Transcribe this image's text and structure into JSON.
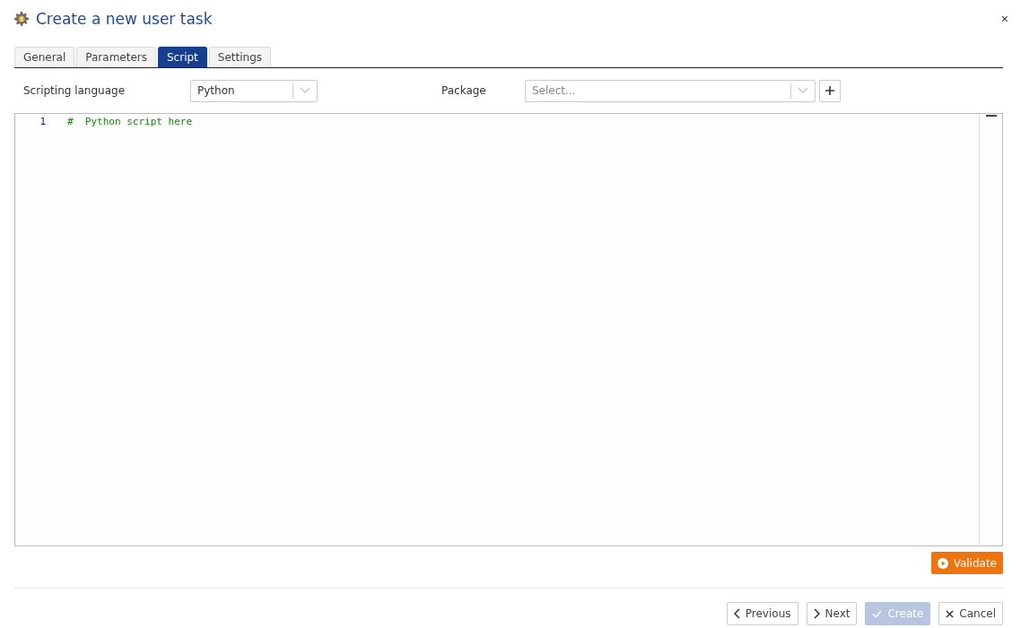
{
  "dialog": {
    "title": "Create a new user task",
    "close": "×"
  },
  "tabs": [
    {
      "label": "General",
      "selected": false
    },
    {
      "label": "Parameters",
      "selected": false
    },
    {
      "label": "Script",
      "selected": true
    },
    {
      "label": "Settings",
      "selected": false
    }
  ],
  "fields": [
    {
      "label": "Scripting language",
      "value": "Python",
      "add_button": false
    },
    {
      "label": "Package",
      "placeholder": "Select...",
      "add_button": true
    }
  ],
  "editor": {
    "lines": [
      {
        "number": "1",
        "text": "#  Python script here"
      }
    ]
  },
  "validate_button": "Validate",
  "footer_buttons": [
    {
      "label": "Previous",
      "kind": "previous",
      "disabled": false
    },
    {
      "label": "Next",
      "kind": "next",
      "disabled": false
    },
    {
      "label": "Create",
      "kind": "create",
      "disabled": true
    },
    {
      "label": "Cancel",
      "kind": "cancel",
      "disabled": false
    }
  ]
}
